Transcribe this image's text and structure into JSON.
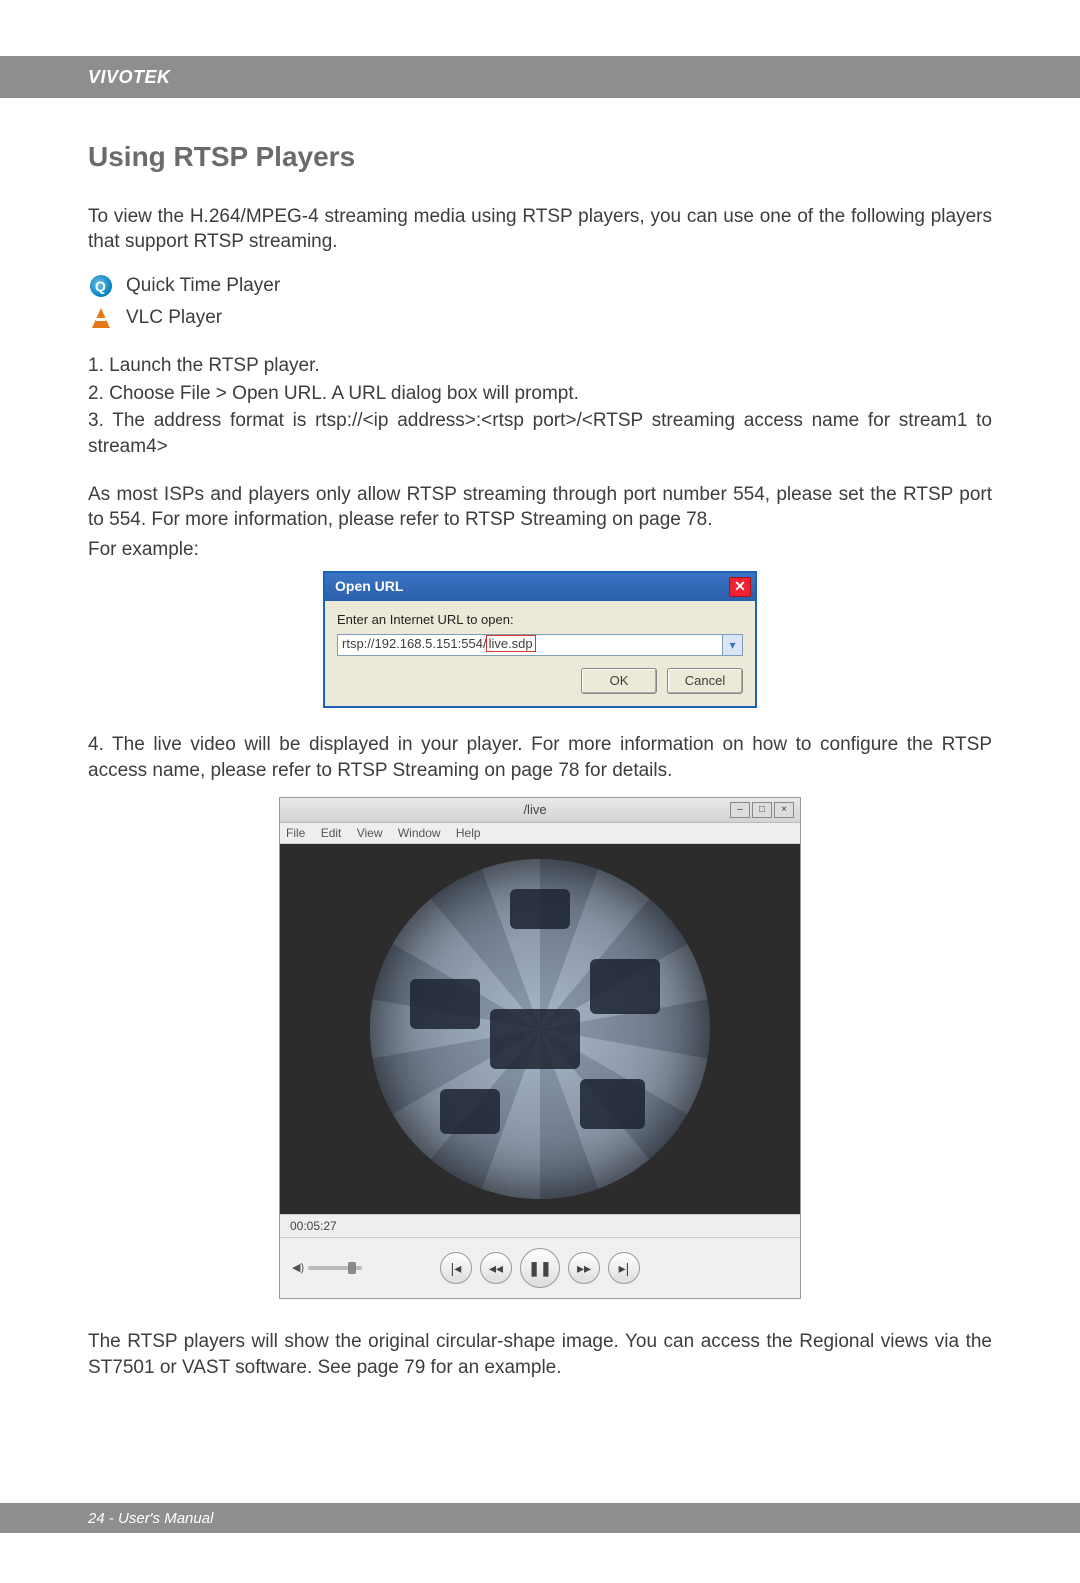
{
  "header": {
    "brand": "VIVOTEK"
  },
  "title": "Using RTSP Players",
  "intro": "To view the H.264/MPEG-4 streaming media using RTSP players, you can use one of the following players that support RTSP streaming.",
  "players": [
    {
      "icon": "quicktime-icon",
      "name": "Quick Time Player"
    },
    {
      "icon": "vlc-icon",
      "name": "VLC Player"
    }
  ],
  "steps": {
    "s1": "1. Launch the RTSP player.",
    "s2": "2. Choose File > Open URL. A URL dialog box will prompt.",
    "s3": "3. The address format is rtsp://<ip address>:<rtsp port>/<RTSP streaming access name for stream1 to stream4>"
  },
  "note1": "As most ISPs and players only allow RTSP streaming through port number 554, please set the RTSP port to 554. For more information, please refer to RTSP Streaming on page 78.",
  "for_example": "For example:",
  "dialog": {
    "title": "Open URL",
    "label": "Enter an Internet URL to open:",
    "url_base": "rtsp://192.168.5.151:554/",
    "url_hl": "live.sdp",
    "ok": "OK",
    "cancel": "Cancel"
  },
  "step4": "4. The live video will be displayed in your player. For more information on how to configure the RTSP access name, please refer to RTSP Streaming on page 78 for details.",
  "player_window": {
    "title": "/live",
    "menu": [
      "File",
      "Edit",
      "View",
      "Window",
      "Help"
    ],
    "timestamp": "00:05:27",
    "volume_label": "◀)"
  },
  "closing": "The RTSP players will show the original circular-shape image. You can access the Regional views via the ST7501 or VAST software. See page 79 for an example.",
  "footer": {
    "page": "24 - User's Manual"
  }
}
